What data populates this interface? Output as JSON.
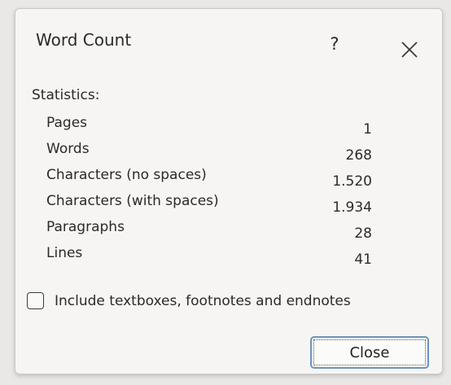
{
  "dialog": {
    "title": "Word Count",
    "help_label": "?",
    "close_icon": "close-icon"
  },
  "statistics": {
    "heading": "Statistics:",
    "rows": [
      {
        "label": "Pages",
        "value": "1"
      },
      {
        "label": "Words",
        "value": "268"
      },
      {
        "label": "Characters (no spaces)",
        "value": "1.520"
      },
      {
        "label": "Characters (with spaces)",
        "value": "1.934"
      },
      {
        "label": "Paragraphs",
        "value": "28"
      },
      {
        "label": "Lines",
        "value": "41"
      }
    ]
  },
  "options": {
    "include_label": "Include textboxes, footnotes and endnotes",
    "include_checked": false
  },
  "buttons": {
    "close_label": "Close"
  }
}
